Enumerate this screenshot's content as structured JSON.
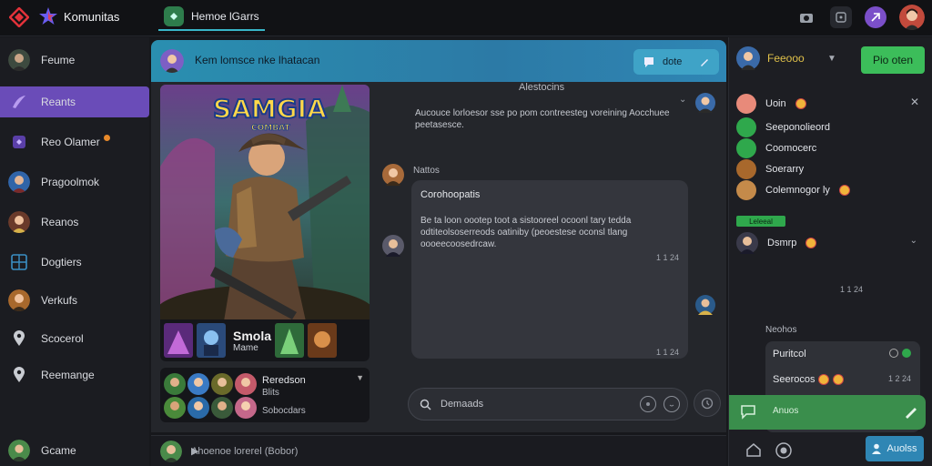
{
  "app": {
    "brand": "Komunitas",
    "active_tab": "Hemoe lGarrs"
  },
  "colors": {
    "accent_purple": "#6a4cb8",
    "header_blue": "#2c7aa6",
    "green": "#3cbd5a",
    "profile_blue": "#2f86b4"
  },
  "sidebar": {
    "items": [
      {
        "label": "Feume",
        "icon": "user-avatar-icon"
      },
      {
        "label": "Reants",
        "icon": "sword-icon"
      },
      {
        "label": "Reo Olamer",
        "icon": "game-controller-icon"
      },
      {
        "label": "Pragoolmok",
        "icon": "user-avatar-icon"
      },
      {
        "label": "Reanos",
        "icon": "user-avatar-icon"
      },
      {
        "label": "Dogtiers",
        "icon": "grid-icon"
      },
      {
        "label": "Verkufs",
        "icon": "user-avatar-icon"
      },
      {
        "label": "Scocerol",
        "icon": "location-pin-icon"
      },
      {
        "label": "Reemange",
        "icon": "location-pin-icon"
      }
    ],
    "footer": "Gcame"
  },
  "channel": {
    "title": "Kem lomsce nke lhatacan",
    "share_label": "dote"
  },
  "game": {
    "logo": "SAMGIA",
    "logo_sub": "COMBAT",
    "name": "Smola",
    "subtitle": "Mame"
  },
  "members": {
    "title": "Reredson",
    "sub": "Blits",
    "foot": "Sobocdars"
  },
  "thread": {
    "header": "Alestocins",
    "intro": "Aucouce lorloesor sse po pom contreesteg voreining Aocchuee peetasesce.",
    "author": "Nattos",
    "bubble_title": "Corohoopatis",
    "bubble_body": "Be ta loon oootep toot a sistooreel ocoonl tary tedda odtiteolsoserreods oatiniby (peoestese oconsl tlang oooeecoosedrcaw.",
    "time1": "1 1 24",
    "time2": "1 1 24"
  },
  "search": {
    "placeholder": "Demaads"
  },
  "composer": {
    "placeholder": "Ahoenoe lorerel (Bobor)"
  },
  "right": {
    "user": "Feeooo",
    "join_label": "Pio oten",
    "rows": [
      {
        "label": "Uoin"
      },
      {
        "label": "Seeponolieord"
      },
      {
        "label": "Coomocerc"
      },
      {
        "label": "Soerarry"
      },
      {
        "label": "Colemnogor ly"
      }
    ],
    "live_tag": "Leleeal",
    "live_user": "Dsmrp",
    "time": "1 1 24",
    "section": "Neohos",
    "card": {
      "l1": "Puritcol",
      "l2": "Seerocos",
      "time": "1 2 24"
    },
    "greenbar": "Anuos",
    "profile_label": "Auolss"
  }
}
